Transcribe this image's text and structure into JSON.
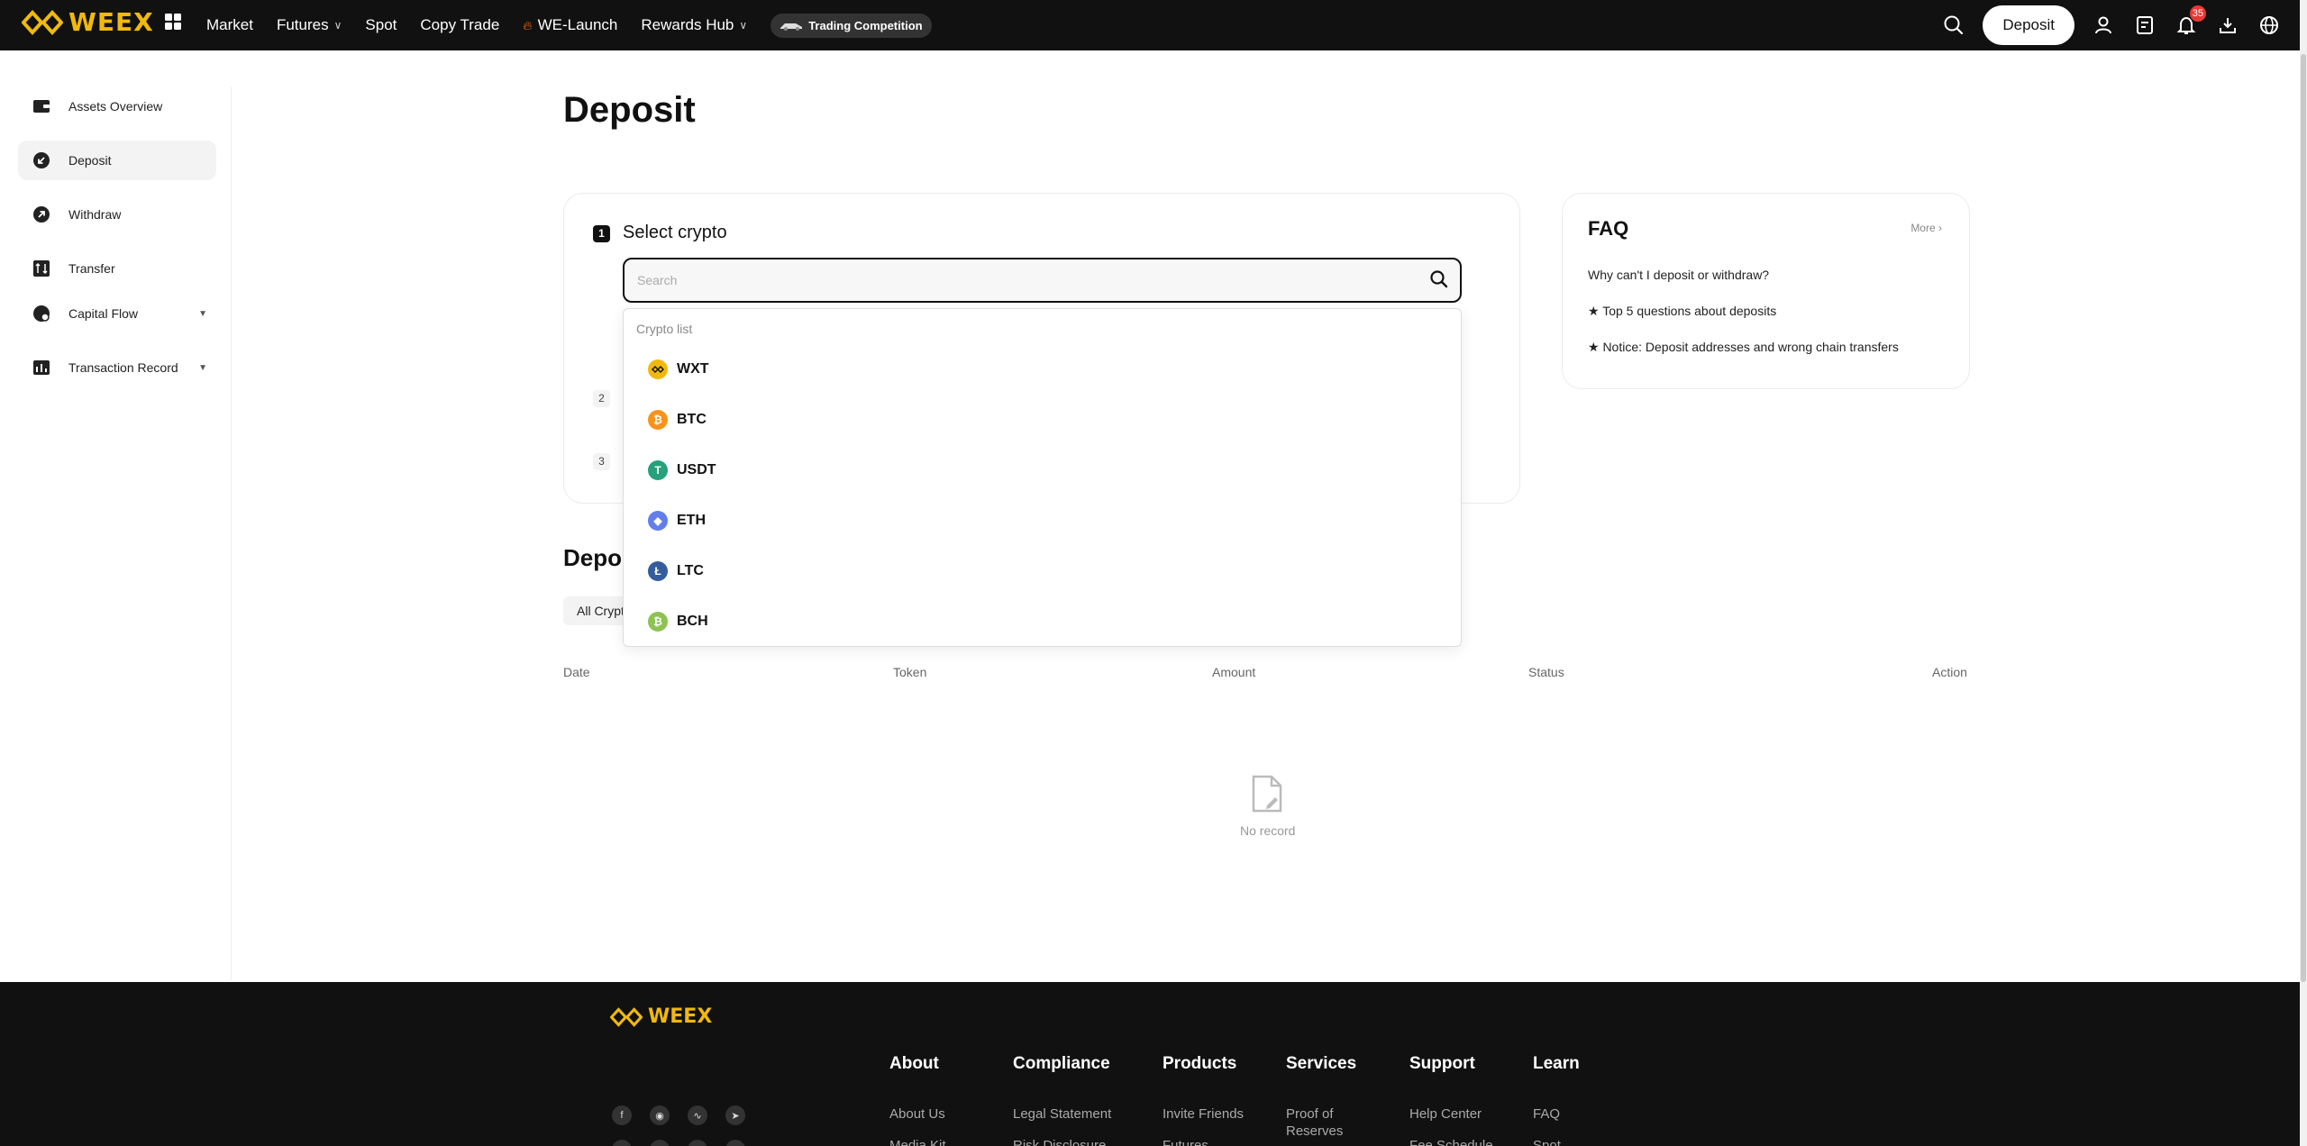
{
  "nav": {
    "logo": "WEEX",
    "items": [
      "Market",
      "Futures",
      "Spot",
      "Copy Trade",
      "WE-Launch",
      "Rewards Hub"
    ],
    "competition": "Trading Competition",
    "deposit_button": "Deposit",
    "notification_count": "35"
  },
  "sidebar": {
    "items": [
      {
        "label": "Assets Overview",
        "icon": "wallet-icon"
      },
      {
        "label": "Deposit",
        "icon": "deposit-icon"
      },
      {
        "label": "Withdraw",
        "icon": "withdraw-icon"
      },
      {
        "label": "Transfer",
        "icon": "transfer-icon"
      },
      {
        "label": "Capital Flow",
        "icon": "capital-flow-icon"
      },
      {
        "label": "Transaction Record",
        "icon": "record-icon"
      }
    ]
  },
  "page": {
    "title": "Deposit"
  },
  "steps": {
    "step1_num": "1",
    "step1_title": "Select crypto",
    "step2_num": "2",
    "step3_num": "3"
  },
  "search": {
    "placeholder": "Search"
  },
  "crypto_list": {
    "label": "Crypto list",
    "coins": [
      {
        "name": "WXT",
        "color": "#f0b90b"
      },
      {
        "name": "BTC",
        "color": "#f7931a"
      },
      {
        "name": "USDT",
        "color": "#26a17b"
      },
      {
        "name": "ETH",
        "color": "#627eea"
      },
      {
        "name": "LTC",
        "color": "#345d9d"
      },
      {
        "name": "BCH",
        "color": "#8dc351"
      }
    ]
  },
  "faq": {
    "title": "FAQ",
    "more": "More",
    "questions": [
      "Why can't I deposit or withdraw?",
      "★ Top 5 questions about deposits",
      "★ Notice: Deposit addresses and wrong chain transfers"
    ]
  },
  "history": {
    "title": "Deposit records",
    "filter": "All Crypto",
    "columns": [
      "Date",
      "Token",
      "Amount",
      "Status",
      "Action"
    ],
    "empty": "No record"
  },
  "footer": {
    "logo": "WEEX",
    "columns": [
      {
        "title": "About",
        "links": [
          "About Us",
          "Media Kit"
        ]
      },
      {
        "title": "Compliance",
        "links": [
          "Legal Statement",
          "Risk Disclosure"
        ]
      },
      {
        "title": "Products",
        "links": [
          "Invite Friends",
          "Futures"
        ]
      },
      {
        "title": "Services",
        "links": [
          "Proof of Reserves"
        ]
      },
      {
        "title": "Support",
        "links": [
          "Help Center",
          "Fee Schedule"
        ]
      },
      {
        "title": "Learn",
        "links": [
          "FAQ",
          "Spot"
        ]
      }
    ]
  }
}
